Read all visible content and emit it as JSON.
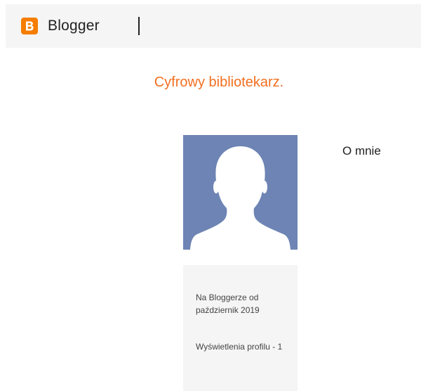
{
  "header": {
    "logo_text": "Blogger",
    "brand_color": "#f57d00"
  },
  "blog": {
    "title": "Cyfrowy bibliotekarz.",
    "title_color": "#f26f21"
  },
  "profile": {
    "about_label": "O mnie",
    "avatar_icon": "default-avatar-silhouette",
    "since_text": "Na Bloggerze od październik 2019",
    "views_text": "Wyświetlenia profilu - 1"
  }
}
